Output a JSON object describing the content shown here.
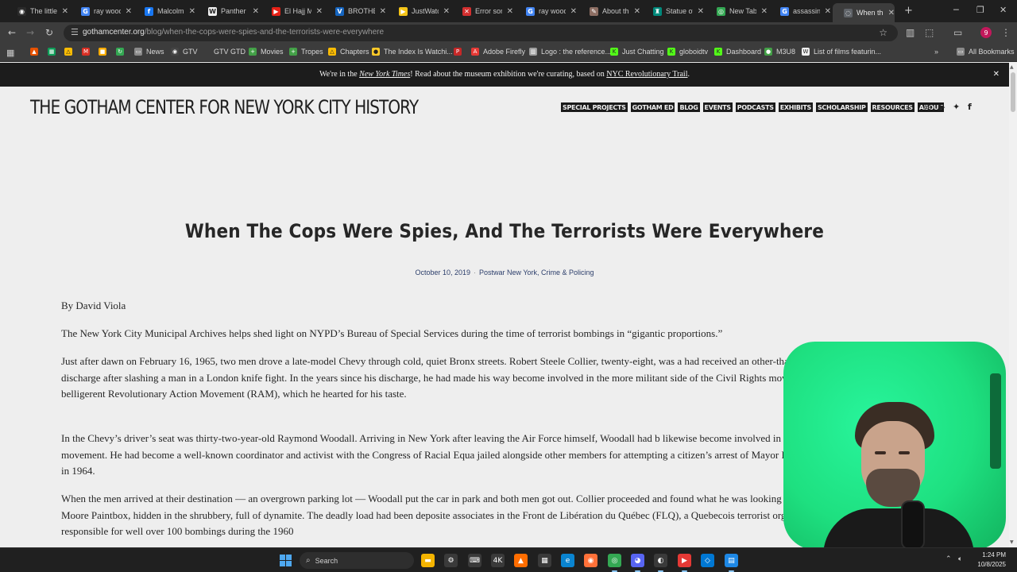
{
  "browser": {
    "tabs": [
      {
        "title": "The little",
        "icon": "github-icon",
        "color": "#2b2b2b",
        "glyph": "◉"
      },
      {
        "title": "ray wood",
        "icon": "google-icon",
        "color": "#4285f4",
        "glyph": "G"
      },
      {
        "title": "Malcolm",
        "icon": "facebook-icon",
        "color": "#1877f2",
        "glyph": "f"
      },
      {
        "title": "Panther 2",
        "icon": "wikipedia-icon",
        "color": "#f0f0f0",
        "glyph": "W"
      },
      {
        "title": "El Hajj M",
        "icon": "youtube-icon",
        "color": "#e62117",
        "glyph": "▶"
      },
      {
        "title": "BROTHER",
        "icon": "v-icon",
        "color": "#1565c0",
        "glyph": "V"
      },
      {
        "title": "JustWatc",
        "icon": "justwatch-icon",
        "color": "#f5c518",
        "glyph": "▶"
      },
      {
        "title": "Error son",
        "icon": "x-icon",
        "color": "#d32f2f",
        "glyph": "✕"
      },
      {
        "title": "ray wood",
        "icon": "google-icon",
        "color": "#4285f4",
        "glyph": "G"
      },
      {
        "title": "About th",
        "icon": "quill-icon",
        "color": "#8d6e63",
        "glyph": "✎"
      },
      {
        "title": "Statue of",
        "icon": "statue-icon",
        "color": "#00897b",
        "glyph": "♜"
      },
      {
        "title": "New Tab",
        "icon": "chrome-icon",
        "color": "#34a853",
        "glyph": "◎"
      },
      {
        "title": "assassina",
        "icon": "google-icon",
        "color": "#4285f4",
        "glyph": "G"
      },
      {
        "title": "When th",
        "icon": "page-icon",
        "color": "#5f6368",
        "glyph": "◌",
        "active": true
      }
    ],
    "url_host": "gothamcenter.org",
    "url_path": "/blog/when-the-cops-were-spies-and-the-terrorists-were-everywhere",
    "profile_initial": "9",
    "bookmarks": [
      {
        "label": "",
        "icon": "firefly-icon",
        "color": "#e65100",
        "glyph": "▲"
      },
      {
        "label": "",
        "icon": "sheets-icon",
        "color": "#0f9d58",
        "glyph": "▦"
      },
      {
        "label": "",
        "icon": "drive-icon",
        "color": "#fbbc04",
        "glyph": "△"
      },
      {
        "label": "",
        "icon": "gmail-icon",
        "color": "#d93025",
        "glyph": "M"
      },
      {
        "label": "",
        "icon": "keep-icon",
        "color": "#f9ab00",
        "glyph": "■"
      },
      {
        "label": "",
        "icon": "refresh-icon",
        "color": "#34a853",
        "glyph": "↻"
      },
      {
        "label": "News",
        "icon": "folder-icon",
        "color": "#8a8a8a",
        "glyph": "▭"
      },
      {
        "label": "GTV",
        "icon": "github-icon",
        "color": "#444444",
        "glyph": "◉"
      },
      {
        "label": "GTV GTD",
        "icon": "blank-icon",
        "color": "#3c3c3c",
        "glyph": ""
      },
      {
        "label": "Movies",
        "icon": "plus-icon",
        "color": "#43a047",
        "glyph": "+"
      },
      {
        "label": "Tropes",
        "icon": "plus-icon",
        "color": "#43a047",
        "glyph": "+"
      },
      {
        "label": "Chapters",
        "icon": "drive-icon",
        "color": "#fbbc04",
        "glyph": "△"
      },
      {
        "label": "The Index Is Watchi...",
        "icon": "pin-icon",
        "color": "#ffca28",
        "glyph": "●"
      },
      {
        "label": "",
        "icon": "pdf-icon",
        "color": "#c62828",
        "glyph": "P"
      },
      {
        "label": "Adobe Firefly",
        "icon": "adobe-icon",
        "color": "#e53935",
        "glyph": "A"
      },
      {
        "label": "Logo : the reference...",
        "icon": "doc-icon",
        "color": "#9e9e9e",
        "glyph": "▥"
      },
      {
        "label": "Just Chatting",
        "icon": "kick-icon",
        "color": "#53fc18",
        "glyph": "K"
      },
      {
        "label": "globoidtv",
        "icon": "kick-icon",
        "color": "#53fc18",
        "glyph": "K"
      },
      {
        "label": "Dashboard",
        "icon": "kick-icon",
        "color": "#53fc18",
        "glyph": "K"
      },
      {
        "label": "M3U8",
        "icon": "circle-icon",
        "color": "#43a047",
        "glyph": "●"
      },
      {
        "label": "List of films featurin...",
        "icon": "wikipedia-icon",
        "color": "#f0f0f0",
        "glyph": "W"
      }
    ],
    "all_bookmarks": "All Bookmarks"
  },
  "announcement": {
    "prefix": "We're in the ",
    "nyt": "New York Times",
    "middle": "! Read about the museum exhibition we're curating, based on ",
    "link": "NYC Revolutionary Trail",
    "suffix": "."
  },
  "site": {
    "title": "THE GOTHAM CENTER FOR NEW YORK CITY HISTORY",
    "nav": [
      "SPECIAL PROJECTS",
      "GOTHAM ED",
      "BLOG",
      "EVENTS",
      "PODCASTS",
      "EXHIBITS",
      "SCHOLARSHIP",
      "RESOURCES",
      "ABOUT"
    ]
  },
  "article": {
    "title": "When The Cops Were Spies, And The Terrorists Were Everywhere",
    "date": "October 10, 2019",
    "categories": "Postwar New York, Crime & Policing",
    "byline": "By David Viola",
    "paragraphs": [
      "The New York City Municipal Archives helps shed light on NYPD’s Bureau of Special Services during the time of terrorist bombings in “gigantic proportions.”",
      "Just after dawn on February 16, 1965, two men drove a late-model Chevy through cold, quiet Bronx streets. Robert Steele Collier, twenty-eight, was a had received an other-than-honorable discharge after slashing a man in a London knife fight. In the years since his discharge, he had made his way become involved in the more militant side of the Civil Rights movement. Even the belligerent Revolutionary Action Movement (RAM), which he hearted for his taste.",
      "In the Chevy’s driver’s seat was thirty-two-year-old Raymond Woodall. Arriving in New York after leaving the Air Force himself, Woodall had b likewise become involved in the Civil Rights movement. He had become a well-known coordinator and activist with the Congress of Racial Equa jailed alongside other members for attempting a citizen’s arrest of Mayor Robert Wagner, Jr., in 1964.",
      "When the men arrived at their destination — an overgrown parking lot — Woodall put the car in park and both men got out. Collier proceeded and found what he was looking for — a Benjamin Moore Paintbox, hidden in the shrubbery, full of dynamite. The deadly load had been deposite associates in the Front de Libération du Québec (FLQ), a Quebecois terrorist organization responsible for well over 100 bombings during the 1960"
    ]
  },
  "taskbar": {
    "search_placeholder": "Search",
    "time": "1:24 PM",
    "date": "10/8/2025"
  }
}
